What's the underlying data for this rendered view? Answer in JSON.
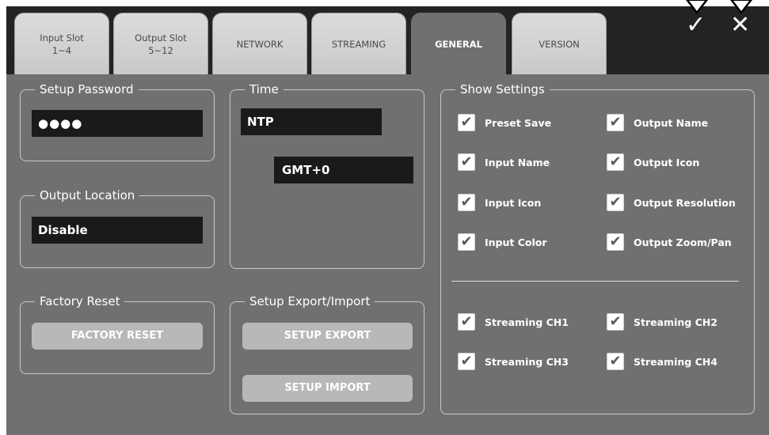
{
  "tabs": [
    {
      "line1": "Input Slot",
      "line2": "1~4"
    },
    {
      "line1": "Output Slot",
      "line2": "5~12"
    },
    {
      "line1": "NETWORK",
      "line2": ""
    },
    {
      "line1": "STREAMING",
      "line2": ""
    },
    {
      "line1": "GENERAL",
      "line2": ""
    },
    {
      "line1": "VERSION",
      "line2": ""
    }
  ],
  "active_tab": "GENERAL",
  "header": {
    "confirm_glyph": "✓",
    "cancel_glyph": "✕"
  },
  "setup_password": {
    "title": "Setup Password",
    "value": "●●●●"
  },
  "output_location": {
    "title": "Output Location",
    "value": "Disable"
  },
  "factory_reset": {
    "title": "Factory Reset",
    "button": "FACTORY RESET"
  },
  "time": {
    "title": "Time",
    "mode": "NTP",
    "timezone": "GMT+0"
  },
  "setup_export_import": {
    "title": "Setup Export/Import",
    "export_button": "SETUP EXPORT",
    "import_button": "SETUP IMPORT"
  },
  "show_settings": {
    "title": "Show Settings",
    "items": [
      {
        "label": "Preset Save",
        "checked": true
      },
      {
        "label": "Output Name",
        "checked": true
      },
      {
        "label": "Input Name",
        "checked": true
      },
      {
        "label": "Output Icon",
        "checked": true
      },
      {
        "label": "Input Icon",
        "checked": true
      },
      {
        "label": "Output Resolution",
        "checked": true
      },
      {
        "label": "Input Color",
        "checked": true
      },
      {
        "label": "Output Zoom/Pan",
        "checked": true
      }
    ],
    "streaming": [
      {
        "label": "Streaming CH1",
        "checked": true
      },
      {
        "label": "Streaming CH2",
        "checked": true
      },
      {
        "label": "Streaming CH3",
        "checked": true
      },
      {
        "label": "Streaming CH4",
        "checked": true
      }
    ],
    "check_glyph": "✔"
  },
  "colors": {
    "active_tab": "#707070",
    "panel": "#707070",
    "field": "#1a1a1a",
    "button": "#b8b8b8"
  }
}
